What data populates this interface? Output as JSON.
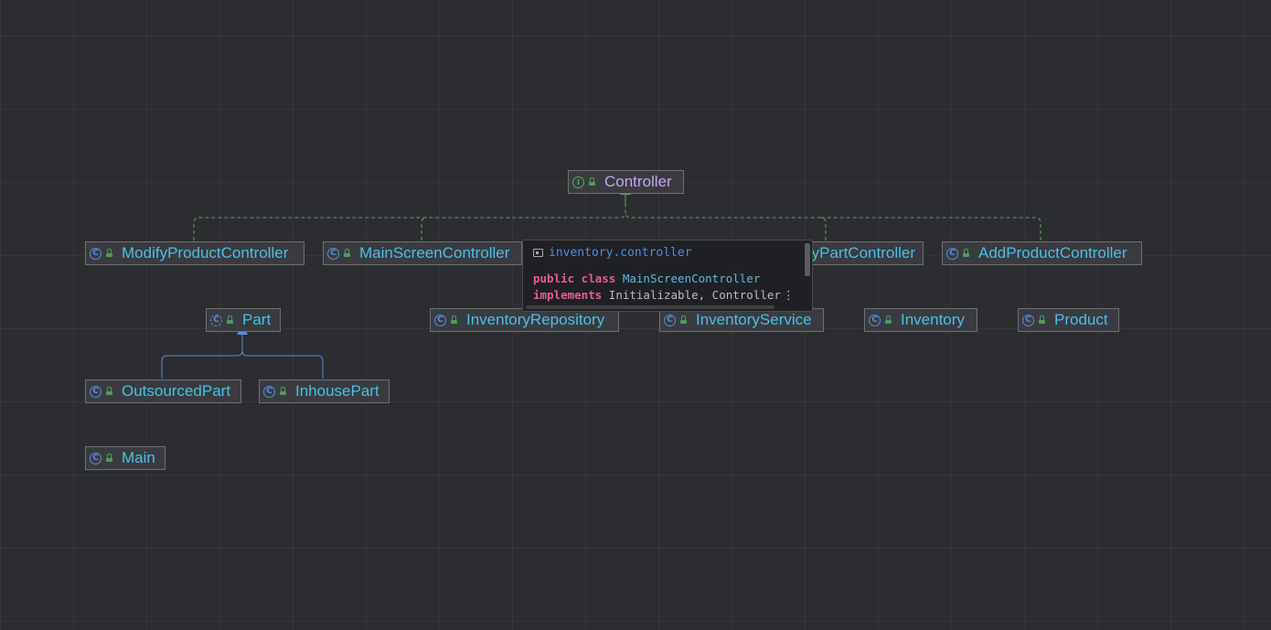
{
  "diagram": {
    "nodes": [
      {
        "id": "controller",
        "label": "Controller",
        "kind": "interface",
        "kind_icon": "interface-icon",
        "visibility_icon": "public-lock-icon"
      },
      {
        "id": "modify-product-controller",
        "label": "ModifyProductController",
        "kind": "class",
        "kind_icon": "class-icon",
        "visibility_icon": "public-lock-icon"
      },
      {
        "id": "main-screen-controller",
        "label": "MainScreenController",
        "kind": "class",
        "kind_icon": "class-icon",
        "visibility_icon": "public-lock-icon"
      },
      {
        "id": "modify-part-controller",
        "label": "ModifyPartController",
        "kind": "class",
        "kind_icon": "class-icon",
        "visibility_icon": "public-lock-icon"
      },
      {
        "id": "add-product-controller",
        "label": "AddProductController",
        "kind": "class",
        "kind_icon": "class-icon",
        "visibility_icon": "public-lock-icon"
      },
      {
        "id": "part",
        "label": "Part",
        "kind": "abstract-class",
        "kind_icon": "abstract-class-icon",
        "visibility_icon": "public-lock-icon"
      },
      {
        "id": "inventory-repository",
        "label": "InventoryRepository",
        "kind": "class",
        "kind_icon": "class-icon",
        "visibility_icon": "public-lock-icon"
      },
      {
        "id": "inventory-service",
        "label": "InventoryService",
        "kind": "class",
        "kind_icon": "class-icon",
        "visibility_icon": "public-lock-icon"
      },
      {
        "id": "inventory",
        "label": "Inventory",
        "kind": "class",
        "kind_icon": "class-icon",
        "visibility_icon": "public-lock-icon"
      },
      {
        "id": "product",
        "label": "Product",
        "kind": "class",
        "kind_icon": "class-icon",
        "visibility_icon": "public-lock-icon"
      },
      {
        "id": "outsourced-part",
        "label": "OutsourcedPart",
        "kind": "class",
        "kind_icon": "class-icon",
        "visibility_icon": "public-lock-icon"
      },
      {
        "id": "inhouse-part",
        "label": "InhousePart",
        "kind": "class",
        "kind_icon": "class-icon",
        "visibility_icon": "public-lock-icon"
      },
      {
        "id": "main",
        "label": "Main",
        "kind": "class",
        "kind_icon": "class-icon",
        "visibility_icon": "public-lock-icon"
      }
    ],
    "edges": [
      {
        "from": "modify-product-controller",
        "to": "controller",
        "type": "implements"
      },
      {
        "from": "main-screen-controller",
        "to": "controller",
        "type": "implements"
      },
      {
        "from": "modify-part-controller",
        "to": "controller",
        "type": "implements"
      },
      {
        "from": "add-product-controller",
        "to": "controller",
        "type": "implements"
      },
      {
        "from": "outsourced-part",
        "to": "part",
        "type": "extends"
      },
      {
        "from": "inhouse-part",
        "to": "part",
        "type": "extends"
      }
    ],
    "colors": {
      "background": "#2b2d30",
      "class_label": "#4dbfe3",
      "interface_label": "#c7a5ef",
      "implements_edge": "#5ea85e",
      "extends_edge": "#5b8ddb"
    }
  },
  "popup": {
    "package_icon": "package-icon",
    "package": "inventory.controller",
    "line1_kw": "public class",
    "line1_name": "MainScreenController",
    "line2_kw": "implements",
    "line2_rest": "Initializable, Controller",
    "more_icon": "more-vertical-icon"
  }
}
